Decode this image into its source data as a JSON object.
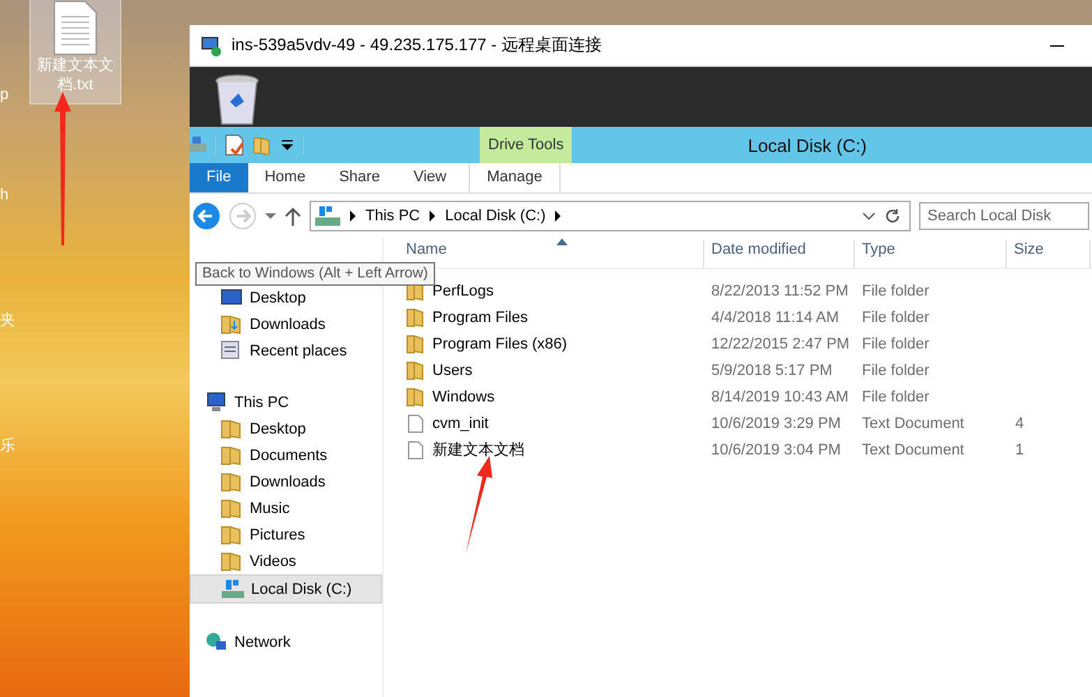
{
  "desktop": {
    "cut_labels": [
      "p",
      "h",
      "夹",
      "乐"
    ],
    "file_icon": {
      "label": "新建文本文档.txt",
      "selected": true
    }
  },
  "rdp_window": {
    "title": "ins-539a5vdv-49 - 49.235.175.177 - 远程桌面连接"
  },
  "explorer": {
    "context_group": "Drive Tools",
    "title": "Local Disk (C:)",
    "tabs": [
      {
        "label": "File",
        "kind": "file"
      },
      {
        "label": "Home",
        "kind": "tab"
      },
      {
        "label": "Share",
        "kind": "tab"
      },
      {
        "label": "View",
        "kind": "tab"
      },
      {
        "label": "Manage",
        "kind": "contextual"
      }
    ],
    "back": {
      "disabled": false
    },
    "forward": {
      "disabled": true
    },
    "breadcrumb": [
      "This PC",
      "Local Disk (C:)"
    ],
    "search": {
      "placeholder": "Search Local Disk"
    },
    "tooltip": "Back to Windows (Alt + Left Arrow)",
    "columns": [
      "Name",
      "Date modified",
      "Type",
      "Size"
    ],
    "nav": [
      {
        "items": [
          {
            "label": "Desktop",
            "kind": "desktop",
            "selected": false
          },
          {
            "label": "Downloads",
            "kind": "downloads",
            "selected": false
          },
          {
            "label": "Recent places",
            "kind": "recent",
            "selected": false
          }
        ]
      },
      {
        "label": "This PC",
        "kind": "pc",
        "selected": false,
        "children": [
          {
            "label": "Desktop",
            "kind": "folder",
            "selected": false
          },
          {
            "label": "Documents",
            "kind": "folder",
            "selected": false
          },
          {
            "label": "Downloads",
            "kind": "folder",
            "selected": false
          },
          {
            "label": "Music",
            "kind": "folder",
            "selected": false
          },
          {
            "label": "Pictures",
            "kind": "folder",
            "selected": false
          },
          {
            "label": "Videos",
            "kind": "folder",
            "selected": false
          },
          {
            "label": "Local Disk (C:)",
            "kind": "disk",
            "selected": true
          }
        ]
      },
      {
        "label": "Network",
        "kind": "network",
        "selected": false
      }
    ],
    "rows": [
      {
        "name": "PerfLogs",
        "kind": "folder",
        "date": "8/22/2013 11:52 PM",
        "type": "File folder"
      },
      {
        "name": "Program Files",
        "kind": "folder",
        "date": "4/4/2018 11:14 AM",
        "type": "File folder"
      },
      {
        "name": "Program Files (x86)",
        "kind": "folder",
        "date": "12/22/2015 2:47 PM",
        "type": "File folder"
      },
      {
        "name": "Users",
        "kind": "folder",
        "date": "5/9/2018 5:17 PM",
        "type": "File folder"
      },
      {
        "name": "Windows",
        "kind": "folder",
        "date": "8/14/2019 10:43 AM",
        "type": "File folder"
      },
      {
        "name": "cvm_init",
        "kind": "file",
        "date": "10/6/2019 3:29 PM",
        "type": "Text Document",
        "size": "4"
      },
      {
        "name": "新建文本文档",
        "kind": "file",
        "date": "10/6/2019 3:04 PM",
        "type": "Text Document",
        "size": "1"
      }
    ]
  }
}
